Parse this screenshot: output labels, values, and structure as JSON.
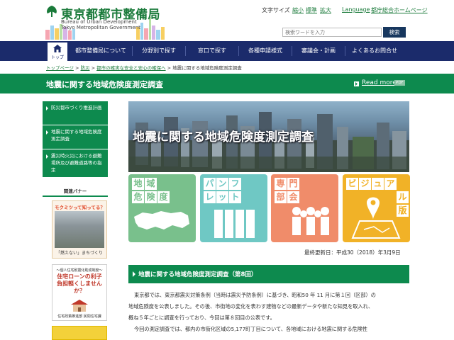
{
  "header": {
    "site_title": "東京都都市整備局",
    "sub_en_1": "Bureau of Urban Development",
    "sub_en_2": "Tokyo Metropolitan Government",
    "font_size_label": "文字サイズ",
    "font_small": "縮小",
    "font_standard": "標準",
    "font_large": "拡大",
    "language": "Language",
    "portal": "都庁総合ホームページ",
    "search_placeholder": "検索ワードを入力",
    "search_button": "検索"
  },
  "nav": {
    "home_label": "トップ",
    "items": [
      "都市整備局について",
      "分野別で探す",
      "窓口で探す",
      "各種申請様式",
      "審議会・計画",
      "よくあるお問合せ"
    ]
  },
  "breadcrumb": {
    "items": [
      "トップページ",
      "防災",
      "都市の確実な安全と安心の確保へ",
      "地震に関する地域危険度測定調査"
    ],
    "separator": ">"
  },
  "title_bar": {
    "title": "地震に関する地域危険度測定調査",
    "readmore": "Read more",
    "pdf": "PDF"
  },
  "sidebar": {
    "items": [
      "防災都市づくり推進計画",
      "地震に関する地域危険度測定調査",
      "震災時火災における避難場所及び避難道路等の指定"
    ],
    "banner_heading": "関連バナー",
    "banner1_title": "モクミツって知ってる？",
    "banner1_caption": "「燃えない」まちづくり",
    "banner2_top": "～個人住宅耐震化助成制度～",
    "banner2_main": "住宅ローンの利子負担軽くしませんか？",
    "banner2_foot": "住宅政策推進部 民間住宅課"
  },
  "hero": {
    "title": "地震に関する地域危険度測定調査"
  },
  "tiles": [
    {
      "name": "地域危険度",
      "chars": [
        "地",
        "域",
        "危",
        "険",
        "度"
      ]
    },
    {
      "name": "パンフレット",
      "chars": [
        "パ",
        "ン",
        "フ",
        "レ",
        "ッ",
        "ト"
      ]
    },
    {
      "name": "専門部会",
      "chars": [
        "専",
        "門",
        "部",
        "会"
      ]
    },
    {
      "name": "ビジュアル版",
      "chars": [
        "ビ",
        "ジ",
        "ュ",
        "ア",
        "ル",
        "版"
      ]
    }
  ],
  "updated": "最終更新日：平成30（2018）年3月9日",
  "section": {
    "title": "地震に関する地域危険度測定調査（第8回）",
    "paragraphs": [
      "東京都では、東京都震災対策条例（当時は震災予防条例）に基づき、昭和50 年 11 月に第１回（区部）の",
      "地域危険度を公表しました。その後、市街地の変化を表わす建物などの最新データや新たな知見を取入れ、",
      "概ね５年ごとに調査を行っており、今回は第８回目の公表です。",
      "今回の測定調査では、都内の市街化区域の5,177町丁目について、各地域における地震に関する危険性"
    ]
  },
  "colors": {
    "green": "#0d8a4e",
    "navy": "#1b2b6b",
    "tile_green": "#79c08c",
    "tile_teal": "#6fc8c4",
    "tile_orange": "#f08c6a",
    "tile_yellow": "#f1b227"
  }
}
